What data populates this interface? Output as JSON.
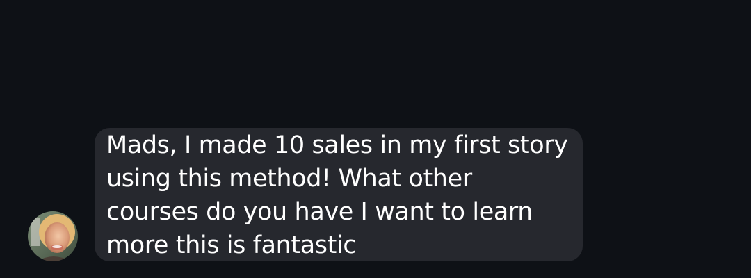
{
  "conversation": {
    "incoming_message": {
      "sender_avatar": "profile-photo",
      "lines": [
        "Mads, I made 10 sales in my first story",
        "using this method! What other",
        "courses do you have I want to learn",
        "more this is fantastic"
      ]
    }
  },
  "theme": {
    "background": "#0e1116",
    "bubble": "#26282e",
    "text": "#ffffff"
  }
}
